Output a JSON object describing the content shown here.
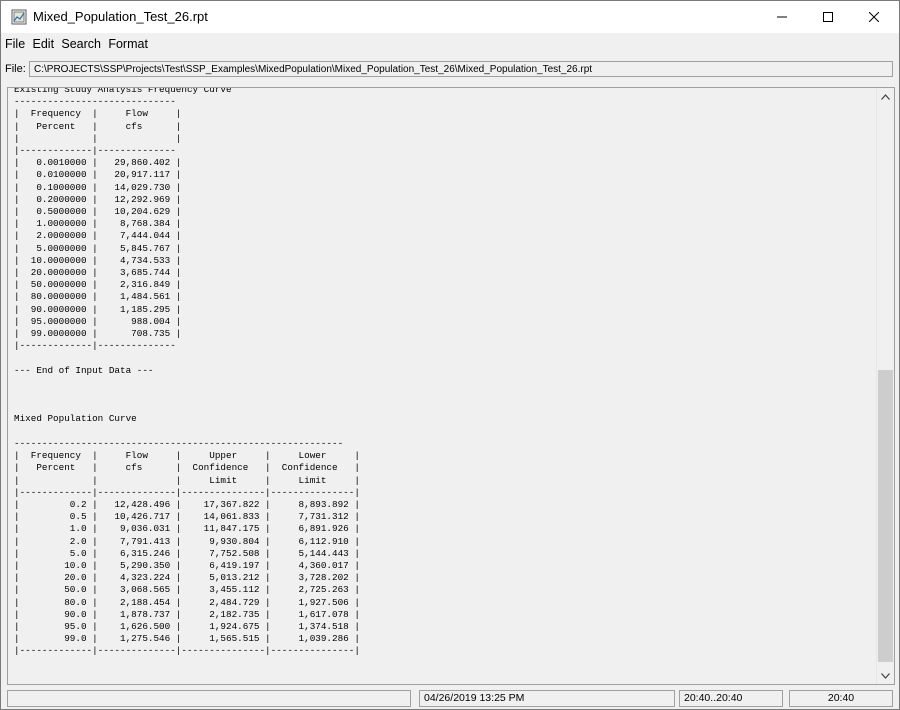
{
  "window": {
    "title": "Mixed_Population_Test_26.rpt"
  },
  "menu": [
    "File",
    "Edit",
    "Search",
    "Format"
  ],
  "file_bar": {
    "label": "File:",
    "path": "C:\\PROJECTS\\SSP\\Projects\\Test\\SSP_Examples\\MixedPopulation\\Mixed_Population_Test_26\\Mixed_Population_Test_26.rpt"
  },
  "report": {
    "lines": [
      "Existing Study Analysis Frequency Curve",
      "-----------------------------",
      "|  Frequency  |     Flow     |",
      "|   Percent   |     cfs      |",
      "|             |              |",
      "|-------------|--------------",
      "|   0.0010000 |   29,860.402 |",
      "|   0.0100000 |   20,917.117 |",
      "|   0.1000000 |   14,029.730 |",
      "|   0.2000000 |   12,292.969 |",
      "|   0.5000000 |   10,204.629 |",
      "|   1.0000000 |    8,768.384 |",
      "|   2.0000000 |    7,444.044 |",
      "|   5.0000000 |    5,845.767 |",
      "|  10.0000000 |    4,734.533 |",
      "|  20.0000000 |    3,685.744 |",
      "|  50.0000000 |    2,316.849 |",
      "|  80.0000000 |    1,484.561 |",
      "|  90.0000000 |    1,185.295 |",
      "|  95.0000000 |      988.004 |",
      "|  99.0000000 |      708.735 |",
      "|-------------|--------------",
      "",
      "--- End of Input Data ---",
      "",
      "",
      "",
      "Mixed Population Curve",
      "",
      "-----------------------------------------------------------",
      "|  Frequency  |     Flow     |     Upper     |     Lower     |",
      "|   Percent   |     cfs      |  Confidence   |  Confidence   |",
      "|             |              |     Limit     |     Limit     |",
      "|-------------|--------------|---------------|---------------|",
      "|         0.2 |   12,428.496 |    17,367.822 |     8,893.892 |",
      "|         0.5 |   10,426.717 |    14,061.833 |     7,731.312 |",
      "|         1.0 |    9,036.031 |    11,847.175 |     6,891.926 |",
      "|         2.0 |    7,791.413 |     9,930.804 |     6,112.910 |",
      "|         5.0 |    6,315.246 |     7,752.508 |     5,144.443 |",
      "|        10.0 |    5,290.350 |     6,419.197 |     4,360.017 |",
      "|        20.0 |    4,323.224 |     5,013.212 |     3,728.202 |",
      "|        50.0 |    3,068.565 |     3,455.112 |     2,725.263 |",
      "|        80.0 |    2,188.454 |     2,484.729 |     1,927.506 |",
      "|        90.0 |    1,878.737 |     2,182.735 |     1,617.078 |",
      "|        95.0 |    1,626.500 |     1,924.675 |     1,374.518 |",
      "|        99.0 |    1,275.546 |     1,565.515 |     1,039.286 |",
      "|-------------|--------------|---------------|---------------|"
    ]
  },
  "status": {
    "cell1": "",
    "datetime": "04/26/2019 13:25 PM",
    "range": "20:40..20:40",
    "time": "20:40"
  }
}
